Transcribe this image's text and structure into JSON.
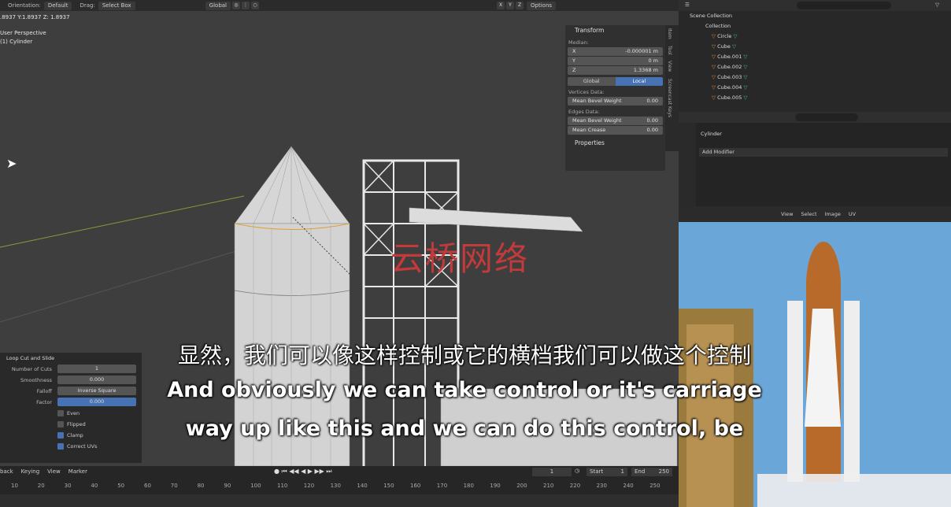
{
  "topbar": {
    "orientation_label": "Orientation:",
    "orientation_value": "Default",
    "drag_label": "Drag:",
    "drag_value": "Select Box",
    "transform_space": "Global",
    "options_label": "Options",
    "axes": [
      "X",
      "Y",
      "Z"
    ]
  },
  "viewport": {
    "coords": ".8937  Y:1.8937  Z: 1.8937",
    "view_name": "User Perspective",
    "object_name": "(1) Cylinder"
  },
  "npanel": {
    "title": "Transform",
    "median_label": "Median:",
    "fields": [
      {
        "axis": "X",
        "value": "-0.000001 m"
      },
      {
        "axis": "Y",
        "value": "0 m"
      },
      {
        "axis": "Z",
        "value": "1.3368 m"
      }
    ],
    "toggle": [
      "Global",
      "Local"
    ],
    "vertices_label": "Vertices Data:",
    "vertex_field": {
      "label": "Mean Bevel Weight",
      "value": "0.00"
    },
    "edges_label": "Edges Data:",
    "edge_fields": [
      {
        "label": "Mean Bevel Weight",
        "value": "0.00"
      },
      {
        "label": "Mean Crease",
        "value": "0.00"
      }
    ],
    "properties_label": "Properties",
    "tabs": [
      "Item",
      "Tool",
      "View",
      "Screencast Keys"
    ]
  },
  "loopcut": {
    "title": "Loop Cut and Slide",
    "rows": [
      {
        "label": "Number of Cuts",
        "value": "1"
      },
      {
        "label": "Smoothness",
        "value": "0.000"
      },
      {
        "label": "Falloff",
        "value": "Inverse Square"
      },
      {
        "label": "Factor",
        "value": "0.000"
      }
    ],
    "checks": [
      {
        "label": "Even",
        "on": false
      },
      {
        "label": "Flipped",
        "on": false
      },
      {
        "label": "Clamp",
        "on": true
      },
      {
        "label": "Correct UVs",
        "on": true
      }
    ]
  },
  "timeline": {
    "menus": [
      "back",
      "Keying",
      "View",
      "Marker"
    ],
    "current_frame": "1",
    "start_label": "Start",
    "start": "1",
    "end_label": "End",
    "end": "250",
    "ticks": [
      "10",
      "20",
      "30",
      "40",
      "50",
      "60",
      "70",
      "80",
      "90",
      "100",
      "110",
      "120",
      "130",
      "140",
      "150",
      "160",
      "170",
      "180",
      "190",
      "200",
      "210",
      "220",
      "230",
      "240",
      "250"
    ]
  },
  "outliner": {
    "scene": "Scene Collection",
    "collection": "Collection",
    "items": [
      "Circle",
      "Cube",
      "Cube.001",
      "Cube.002",
      "Cube.003",
      "Cube.004",
      "Cube.005"
    ]
  },
  "properties": {
    "object": "Cylinder",
    "add_modifier": "Add Modifier"
  },
  "image_editor": {
    "menus": [
      "View",
      "View",
      "Select",
      "Image",
      "UV"
    ]
  },
  "subtitles": {
    "zh": "显然，我们可以像这样控制或它的横档我们可以做这个控制",
    "en1": "And obviously we can take control or it's carriage",
    "en2": "way up like this and we can do this control, be"
  },
  "watermark": "云桥网络"
}
